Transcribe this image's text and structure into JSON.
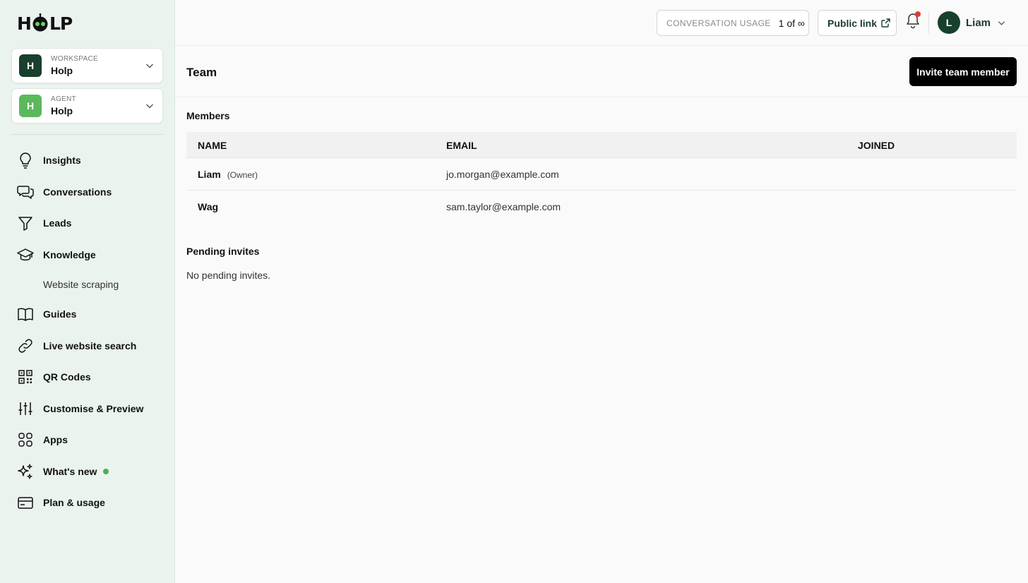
{
  "logo": {
    "text_left": "H",
    "text_right": "LP"
  },
  "workspace": {
    "caption": "WORKSPACE",
    "value": "Holp",
    "initial": "H",
    "color": "#18402d"
  },
  "agent": {
    "caption": "AGENT",
    "value": "Holp",
    "initial": "H",
    "color": "#5cb85c"
  },
  "nav": {
    "insights": "Insights",
    "conversations": "Conversations",
    "leads": "Leads",
    "knowledge": "Knowledge",
    "website_scraping": "Website scraping",
    "guides": "Guides",
    "live_search": "Live website search",
    "qr_codes": "QR Codes",
    "customise": "Customise & Preview",
    "apps": "Apps",
    "whats_new": "What's new",
    "plan": "Plan & usage"
  },
  "topbar": {
    "usage_caption": "CONVERSATION USAGE",
    "usage_value": "1 of ∞",
    "public_link": "Public link",
    "user_initial": "L",
    "user_name": "Liam"
  },
  "page": {
    "title": "Team",
    "invite_button": "Invite team member",
    "members_title": "Members",
    "pending_title": "Pending invites",
    "pending_empty": "No pending invites."
  },
  "table": {
    "headers": {
      "name": "NAME",
      "email": "EMAIL",
      "joined": "JOINED"
    },
    "rows": [
      {
        "name": "Liam",
        "tag": "(Owner)",
        "email": "jo.morgan@example.com",
        "joined": ""
      },
      {
        "name": "Wag",
        "tag": "",
        "email": "sam.taylor@example.com",
        "joined": ""
      }
    ]
  }
}
